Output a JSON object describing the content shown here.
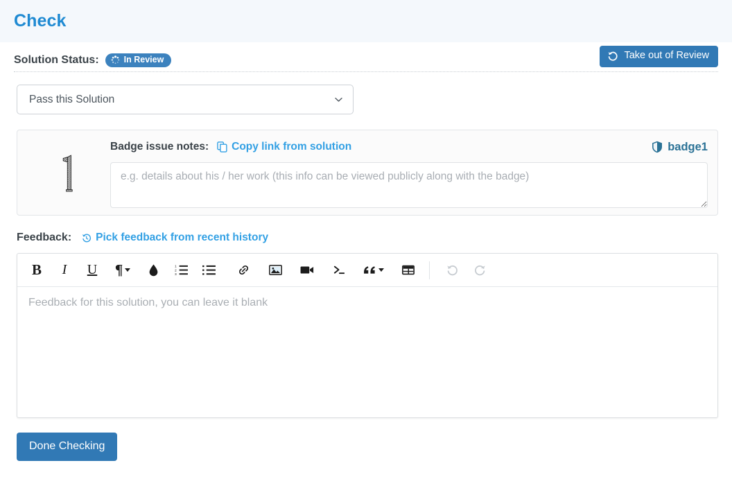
{
  "header": {
    "title": "Check",
    "bg_color": "#f4f8fc",
    "title_color": "#1f8ad2"
  },
  "status": {
    "label": "Solution Status:",
    "badge_text": "In Review",
    "badge_icon": "spinner-icon",
    "badge_color": "#3c82be",
    "take_out_button": {
      "label": "Take out of Review",
      "icon": "undo-icon",
      "color": "#3179b5"
    }
  },
  "decision_select": {
    "selected": "Pass this Solution",
    "icon": "chevron-down-icon",
    "options": [
      "Pass this Solution"
    ]
  },
  "badge_panel": {
    "thumbnail_alt": "1",
    "notes_label": "Badge issue notes:",
    "copy_link": {
      "label": "Copy link from solution",
      "icon": "copy-icon",
      "color": "#32a0e4"
    },
    "badge_name": "badge1",
    "badge_name_icon": "shield-icon",
    "badge_name_color": "#2b7296",
    "notes_value": "",
    "notes_placeholder": "e.g. details about his / her work (this info can be viewed publicly along with the badge)"
  },
  "feedback": {
    "label": "Feedback:",
    "pick_link": {
      "label": "Pick feedback from recent history",
      "icon": "history-icon",
      "color": "#32a0e4"
    },
    "toolbar": [
      {
        "name": "bold-button",
        "glyph": "B",
        "caret": false,
        "disabled": false
      },
      {
        "name": "italic-button",
        "glyph": "I",
        "caret": false,
        "disabled": false
      },
      {
        "name": "underline-button",
        "glyph": "U",
        "caret": false,
        "disabled": false
      },
      {
        "name": "paragraph-style-button",
        "glyph": "¶",
        "caret": true,
        "disabled": false
      },
      {
        "name": "text-color-button",
        "glyph": "drop-icon",
        "caret": false,
        "disabled": false
      },
      {
        "name": "ordered-list-button",
        "glyph": "ordered-list-icon",
        "caret": false,
        "disabled": false
      },
      {
        "name": "unordered-list-button",
        "glyph": "unordered-list-icon",
        "caret": false,
        "disabled": false
      },
      {
        "name": "link-button",
        "glyph": "link-icon",
        "caret": false,
        "disabled": false
      },
      {
        "name": "image-button",
        "glyph": "image-icon",
        "caret": false,
        "disabled": false
      },
      {
        "name": "video-button",
        "glyph": "video-icon",
        "caret": false,
        "disabled": false
      },
      {
        "name": "code-button",
        "glyph": "code-icon",
        "caret": false,
        "disabled": false
      },
      {
        "name": "quote-button",
        "glyph": "quote-icon",
        "caret": true,
        "disabled": false
      },
      {
        "name": "table-button",
        "glyph": "table-icon",
        "caret": false,
        "disabled": false
      },
      {
        "name": "undo-button",
        "glyph": "undo-icon",
        "caret": false,
        "disabled": true
      },
      {
        "name": "redo-button",
        "glyph": "redo-icon",
        "caret": false,
        "disabled": true
      }
    ],
    "editor_value": "",
    "editor_placeholder": "Feedback for this solution, you can leave it blank"
  },
  "footer": {
    "done_button": "Done Checking",
    "done_button_color": "#3179b5"
  }
}
